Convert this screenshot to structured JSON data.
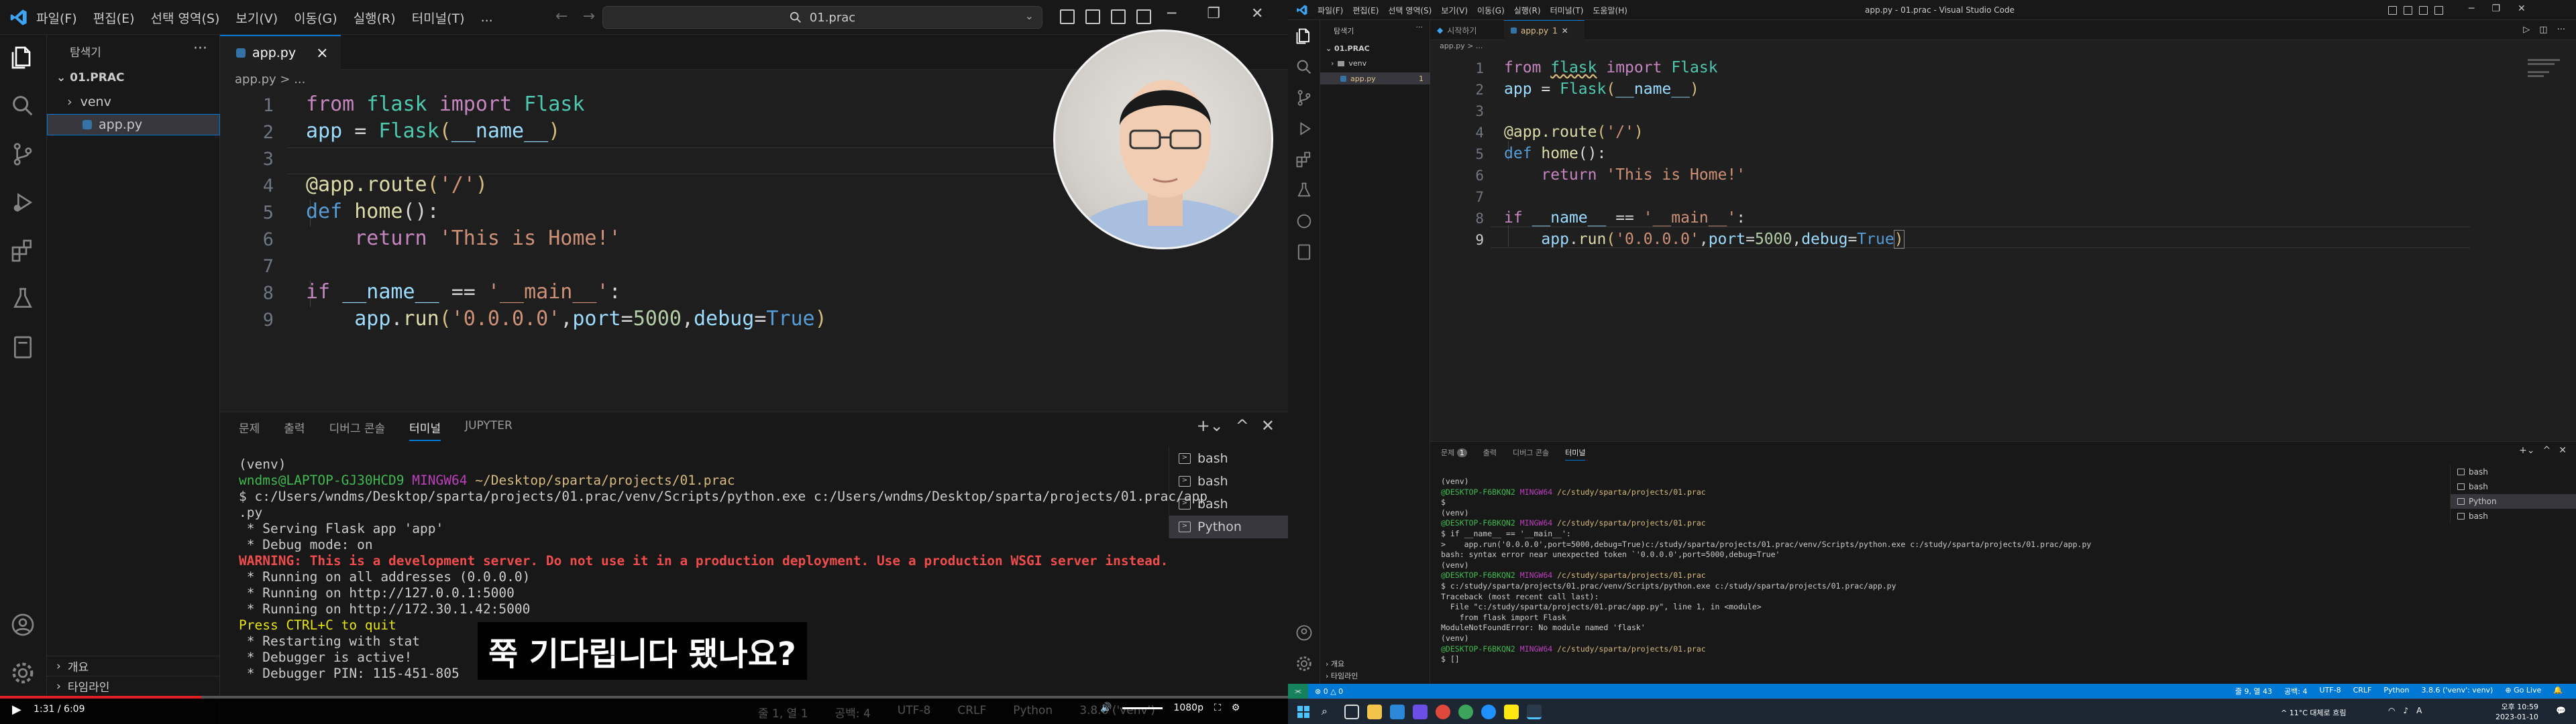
{
  "left_window": {
    "menu": [
      "파일(F)",
      "편집(E)",
      "선택 영역(S)",
      "보기(V)",
      "이동(G)",
      "실행(R)",
      "터미널(T)",
      "..."
    ],
    "command_center": "01.prac",
    "sidebar": {
      "header": "탐색기",
      "project": "01.PRAC",
      "items": [
        {
          "label": "venv"
        },
        {
          "label": "app.py"
        }
      ],
      "bottom": [
        "개요",
        "타임라인"
      ]
    },
    "tab": {
      "label": "app.py",
      "close": "×"
    },
    "breadcrumb": "app.py > ...",
    "code": {
      "line_numbers": [
        "1",
        "2",
        "3",
        "4",
        "5",
        "6",
        "7",
        "8",
        "9"
      ],
      "l1": {
        "a": "from",
        "b": "flask",
        "c": "import",
        "d": "Flask"
      },
      "l2": {
        "a": "app",
        "b": " = ",
        "c": "Flask",
        "d": "(",
        "e": "__name__",
        "f": ")"
      },
      "l4": {
        "a": "@app.route",
        "b": "(",
        "c": "'/'",
        "d": ")"
      },
      "l5": {
        "a": "def",
        "b": "home",
        "c": "():"
      },
      "l6": {
        "a": "return",
        "b": "'This is Home!'"
      },
      "l8": {
        "a": "if",
        "b": "__name__",
        "c": " == ",
        "d": "'__main__'",
        "e": ":"
      },
      "l9": {
        "a": "app",
        "b": ".",
        "c": "run",
        "d": "(",
        "e": "'0.0.0.0'",
        "f": ",",
        "g": "port",
        "h": "=",
        "i": "5000",
        "j": ",",
        "k": "debug",
        "l": "=",
        "m": "True",
        "n": ")"
      }
    },
    "panel": {
      "tabs": [
        "문제",
        "출력",
        "디버그 콘솔",
        "터미널",
        "JUPYTER"
      ],
      "active_tab_index": 3,
      "terminal": {
        "l1": "(venv)",
        "l2_user": "wndms@LAPTOP-GJ30HCD9",
        "l2_host": "MINGW64",
        "l2_path": "~/Desktop/sparta/projects/01.prac",
        "l3": "$ c:/Users/wndms/Desktop/sparta/projects/01.prac/venv/Scripts/python.exe c:/Users/wndms/Desktop/sparta/projects/01.prac/app",
        "l4": ".py",
        "l5": " * Serving Flask app 'app'",
        "l6": " * Debug mode: on",
        "l7": "WARNING: This is a development server. Do not use it in a production deployment. Use a production WSGI server instead.",
        "l8": " * Running on all addresses (0.0.0.0)",
        "l9": " * Running on http://127.0.0.1:5000",
        "l10": " * Running on http://172.30.1.42:5000",
        "l11": "Press CTRL+C to quit",
        "l12": " * Restarting with stat",
        "l13": " * Debugger is active!",
        "l14": " * Debugger PIN: 115-451-805"
      },
      "terminal_list": [
        "bash",
        "bash",
        "bash",
        "Python"
      ]
    },
    "subtitle": "쭉 기다립니다 됐나요?",
    "video": {
      "time": "1:31 / 6:09",
      "quality": "1080p"
    },
    "status_faint": [
      "줄 1, 열 1",
      "공백: 4",
      "UTF-8",
      "CRLF",
      "Python",
      "3.8.6 ('venv')"
    ]
  },
  "right_window": {
    "menu": [
      "파일(F)",
      "편집(E)",
      "선택 영역(S)",
      "보기(V)",
      "이동(G)",
      "실행(R)",
      "터미널(T)",
      "도움말(H)"
    ],
    "title": "app.py - 01.prac - Visual Studio Code",
    "sidebar": {
      "header": "탐색기",
      "project": "01.PRAC",
      "items": [
        {
          "label": "venv"
        },
        {
          "label": "app.py",
          "badge": "1"
        }
      ],
      "bottom": [
        "개요",
        "타임라인"
      ]
    },
    "tabs": [
      {
        "label": "시작하기"
      },
      {
        "label": "app.py",
        "badge": "1"
      }
    ],
    "breadcrumb": "app.py > ...",
    "code": {
      "line_numbers": [
        "1",
        "2",
        "3",
        "4",
        "5",
        "6",
        "7",
        "8",
        "9"
      ],
      "l1": {
        "a": "from",
        "b": "flask",
        "c": "import",
        "d": "Flask"
      },
      "l2": {
        "a": "app",
        "b": " = ",
        "c": "Flask",
        "d": "(",
        "e": "__name__",
        "f": ")"
      },
      "l4": {
        "a": "@app.route",
        "b": "(",
        "c": "'/'",
        "d": ")"
      },
      "l5": {
        "a": "def",
        "b": "home",
        "c": "():"
      },
      "l6": {
        "a": "return",
        "b": "'This is Home!'"
      },
      "l8": {
        "a": "if",
        "b": "__name__",
        "c": " == ",
        "d": "'__main__'",
        "e": ":"
      },
      "l9": {
        "a": "app",
        "b": ".",
        "c": "run",
        "d": "(",
        "e": "'0.0.0.0'",
        "f": ",",
        "g": "port",
        "h": "=",
        "i": "5000",
        "j": ",",
        "k": "debug",
        "l": "=",
        "m": "True",
        "n": ")"
      }
    },
    "panel": {
      "tabs": [
        "문제",
        "출력",
        "디버그 콘솔",
        "터미널"
      ],
      "problems_badge": "1",
      "terminal": {
        "l1": "(venv)",
        "l2_user": "@DESKTOP-F6BKQN2",
        "l2_host": "MINGW64",
        "l2_path": "/c/study/sparta/projects/01.prac",
        "l3": "$",
        "l4": "(venv)",
        "l5_user": "@DESKTOP-F6BKQN2",
        "l5_host": "MINGW64",
        "l5_path": "/c/study/sparta/projects/01.prac",
        "l6": "$ if __name__ == '__main__':",
        "l7": ">    app.run('0.0.0.0',port=5000,debug=True)c:/study/sparta/projects/01.prac/venv/Scripts/python.exe c:/study/sparta/projects/01.prac/app.py",
        "l8": "bash: syntax error near unexpected token `'0.0.0.0',port=5000,debug=True'",
        "l9": "(venv)",
        "l10_user": "@DESKTOP-F6BKQN2",
        "l10_host": "MINGW64",
        "l10_path": "/c/study/sparta/projects/01.prac",
        "l11": "$ c:/study/sparta/projects/01.prac/venv/Scripts/python.exe c:/study/sparta/projects/01.prac/app.py",
        "l12": "Traceback (most recent call last):",
        "l13": "  File \"c:/study/sparta/projects/01.prac/app.py\", line 1, in <module>",
        "l14": "    from flask import Flask",
        "l15": "ModuleNotFoundError: No module named 'flask'",
        "l16": "(venv)",
        "l17_user": "@DESKTOP-F6BKQN2",
        "l17_host": "MINGW64",
        "l17_path": "/c/study/sparta/projects/01.prac",
        "l18": "$ []"
      },
      "terminal_list": [
        "bash",
        "bash",
        "Python",
        "bash"
      ]
    },
    "status": {
      "left": [
        "⊗ 0 △ 0"
      ],
      "right": [
        "줄 9, 열 43",
        "공백: 4",
        "UTF-8",
        "CRLF",
        "Python",
        "3.8.6 ('venv': venv)",
        "⊕ Go Live"
      ]
    },
    "taskbar": {
      "tray": "^ 11°C 대체로 흐림",
      "time": "오후 10:59",
      "date": "2023-01-10"
    }
  },
  "colors": {
    "accent": "#0078d4",
    "status_bar": "#0078d4",
    "editor_bg": "#1f1f1f"
  }
}
